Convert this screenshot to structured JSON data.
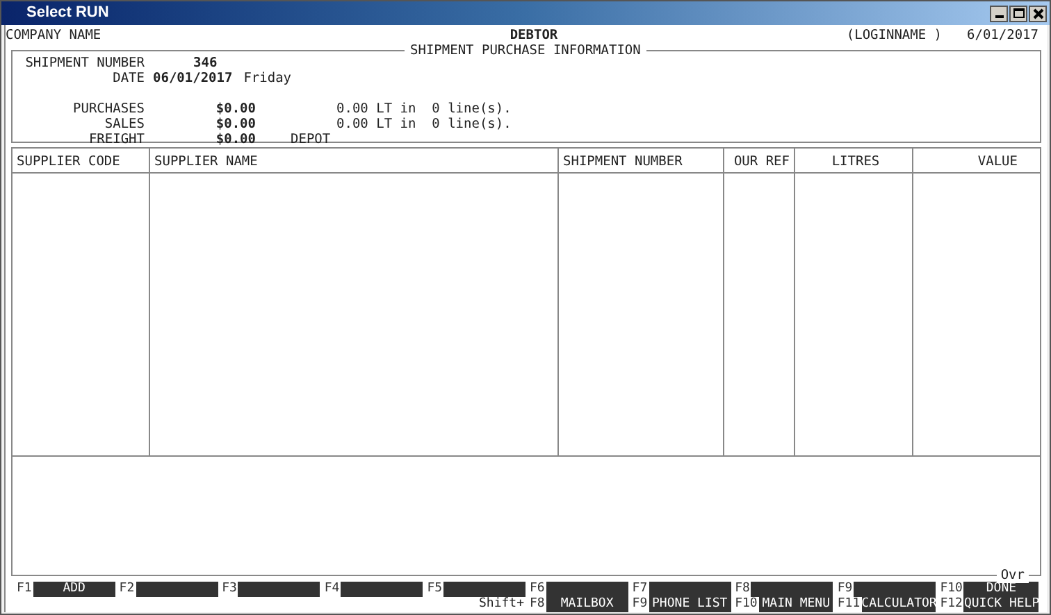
{
  "window": {
    "title": "Select RUN"
  },
  "header": {
    "company": "COMPANY NAME",
    "module": "DEBTOR",
    "user": "(LOGINNAME )",
    "date": "6/01/2017"
  },
  "group": {
    "title": "SHIPMENT PURCHASE INFORMATION",
    "shipment_number": {
      "label": "SHIPMENT NUMBER",
      "value": "346"
    },
    "date": {
      "label": "DATE",
      "value": "06/01/2017",
      "day": "Friday"
    },
    "totals": [
      {
        "label": "PURCHASES",
        "value": "$0.00",
        "litres": "0.00 LT in  0 line(s)."
      },
      {
        "label": "SALES",
        "value": "$0.00",
        "litres": "0.00 LT in  0 line(s)."
      },
      {
        "label": "FREIGHT",
        "value": "$0.00",
        "extra": "DEPOT"
      }
    ]
  },
  "table": {
    "columns": [
      {
        "label": "SUPPLIER CODE"
      },
      {
        "label": "SUPPLIER NAME"
      },
      {
        "label": "SHIPMENT NUMBER"
      },
      {
        "label": "OUR REF"
      },
      {
        "label": "LITRES"
      },
      {
        "label": "VALUE"
      }
    ]
  },
  "status": {
    "mode": "Ovr"
  },
  "function_keys": [
    {
      "key": "F1",
      "label": "ADD"
    },
    {
      "key": "F2"
    },
    {
      "key": "F3"
    },
    {
      "key": "F4"
    },
    {
      "key": "F5"
    },
    {
      "key": "F6"
    },
    {
      "key": "F7"
    },
    {
      "key": "F8"
    },
    {
      "key": "F9"
    },
    {
      "key": "F10",
      "label": "DONE"
    }
  ],
  "shift_label": "Shift+",
  "shift_keys": [
    {
      "key": "F8",
      "label": "MAILBOX"
    },
    {
      "key": "F9",
      "label": "PHONE LIST"
    },
    {
      "key": "F10",
      "label": "MAIN MENU"
    },
    {
      "key": "F11",
      "label": "CALCULATOR"
    },
    {
      "key": "F12",
      "label": "QUICK HELP"
    }
  ]
}
